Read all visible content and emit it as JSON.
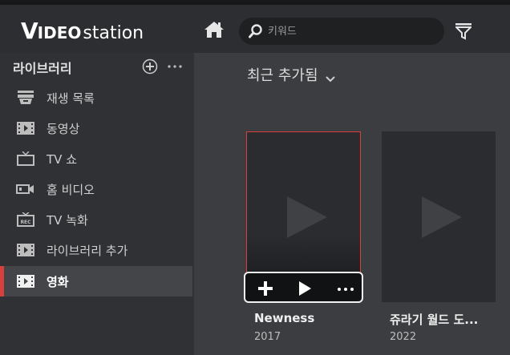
{
  "app": {
    "logo_v": "V",
    "logo_ideo": "IDEO",
    "logo_station": "station"
  },
  "topbar": {
    "search_placeholder": "키워드",
    "icons": [
      "home-icon",
      "search-icon",
      "filter-icon"
    ]
  },
  "sidebar": {
    "header": "라이브러리",
    "items": [
      {
        "label": "재생 목록",
        "icon": "playlist-icon",
        "active": false
      },
      {
        "label": "동영상",
        "icon": "film-icon",
        "active": false
      },
      {
        "label": "TV 쇼",
        "icon": "tv-icon",
        "active": false
      },
      {
        "label": "홈 비디오",
        "icon": "camcorder-icon",
        "active": false
      },
      {
        "label": "TV 녹화",
        "icon": "tv-rec-icon",
        "active": false
      },
      {
        "label": "라이브러리 추가",
        "icon": "film-icon",
        "active": false
      },
      {
        "label": "영화",
        "icon": "film-icon",
        "active": true
      }
    ]
  },
  "main": {
    "title": "최근 추가됨",
    "cards": [
      {
        "title": "Newness",
        "year": "2017",
        "selected": true
      },
      {
        "title": "쥬라기 월드 도...",
        "year": "2022",
        "selected": false
      }
    ]
  },
  "colors": {
    "accent": "#d8403e",
    "topbar": "#2c2e31",
    "sidebar": "#2f3134",
    "main": "#3b3d40"
  }
}
